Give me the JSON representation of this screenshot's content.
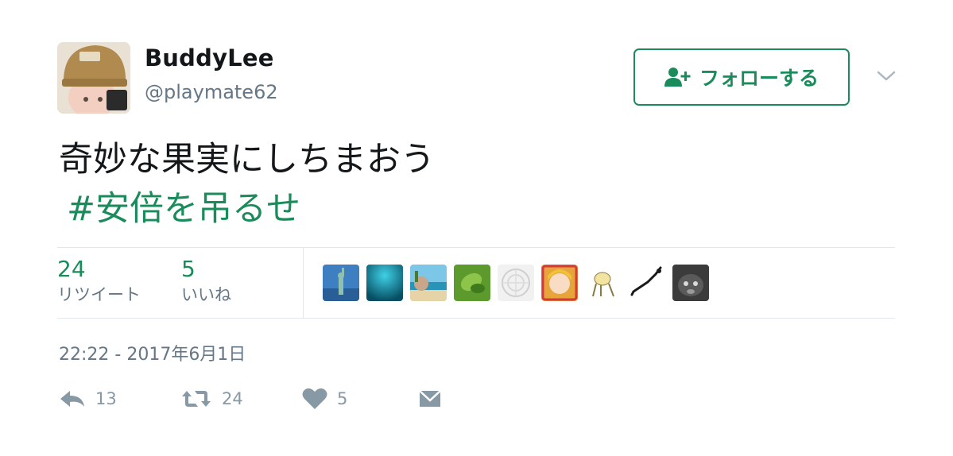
{
  "user": {
    "display_name": "BuddyLee",
    "username": "@playmate62",
    "avatar_icon": "avatar-doll-with-cap"
  },
  "follow_button": {
    "label": "フォローする",
    "icon": "add-user-icon",
    "color": "#1a8c5b"
  },
  "more_menu": {
    "icon": "chevron-down-icon"
  },
  "tweet": {
    "text": "奇妙な果実にしちまおう",
    "hashtag": "#安倍を吊るせ"
  },
  "stats": {
    "retweets": {
      "count": "24",
      "label": "リツイート"
    },
    "likes": {
      "count": "5",
      "label": "いいね"
    }
  },
  "likers": [
    {
      "icon": "statue-of-liberty-avatar",
      "color": "#3d7fc1"
    },
    {
      "icon": "teal-gradient-avatar",
      "color": "#0d8aa6"
    },
    {
      "icon": "beach-avatar",
      "color": "#6cb8d9"
    },
    {
      "icon": "green-leaf-avatar",
      "color": "#6aa53a"
    },
    {
      "icon": "white-pattern-avatar",
      "color": "#e8e8e8"
    },
    {
      "icon": "anime-character-avatar",
      "color": "#e7a43b"
    },
    {
      "icon": "cartoon-cat-avatar",
      "color": "#f3e9b5"
    },
    {
      "icon": "japan-map-avatar",
      "color": "#ffffff"
    },
    {
      "icon": "cat-photo-avatar",
      "color": "#3b3b3b"
    }
  ],
  "timestamp": "22:22 - 2017年6月1日",
  "actions": {
    "reply": {
      "icon": "reply-icon",
      "count": "13"
    },
    "retweet": {
      "icon": "retweet-icon",
      "count": "24"
    },
    "like": {
      "icon": "heart-icon",
      "count": "5"
    },
    "message": {
      "icon": "envelope-icon"
    }
  }
}
